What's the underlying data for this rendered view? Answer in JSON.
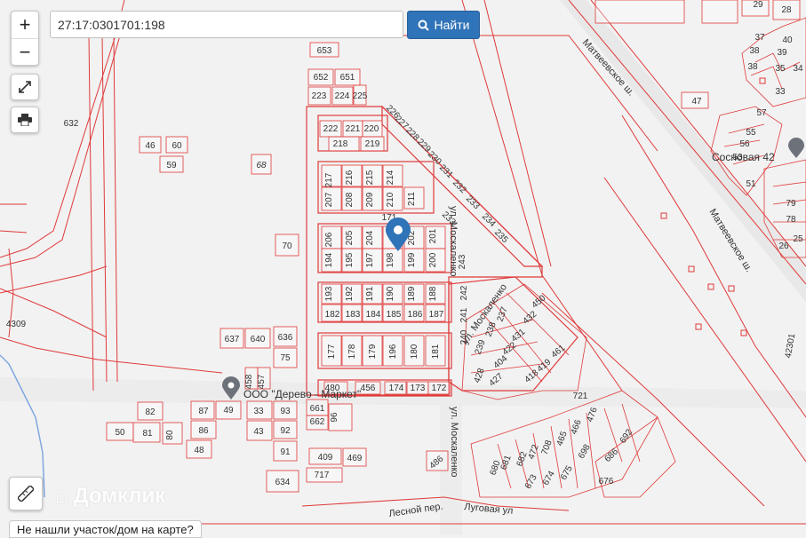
{
  "search": {
    "value": "27:17:0301701:198"
  },
  "find_button": {
    "label": "Найти"
  },
  "controls": {
    "zoom_in": "+",
    "zoom_out": "−"
  },
  "not_found_link": "Не нашли участок/дом на карте?",
  "brand": "Домклик",
  "colors": {
    "parcel": "#e03a3a",
    "marker": "#2f73b8",
    "button": "#2f73b8"
  },
  "map": {
    "streets": {
      "matveevskoe_top": "Матвеевское ш.",
      "matveevskoe_bottom": "Матвеевское ш.",
      "moskalenko_1": "ул. Москаленко",
      "moskalenko_2": "ул. Москаленко",
      "moskalenko_3": "ул. Москаленко",
      "lesnoy": "Лесной пер.",
      "lugovaya": "Луговая ул"
    },
    "pois": {
      "derevo_market": "ООО \"Дерево - Маркет\"",
      "sosnovaya": "Сосновая 42"
    },
    "area_labels": {
      "a632": "632",
      "a4309": "4309",
      "a42301": "42301",
      "a171": "171",
      "a721": "721"
    }
  }
}
